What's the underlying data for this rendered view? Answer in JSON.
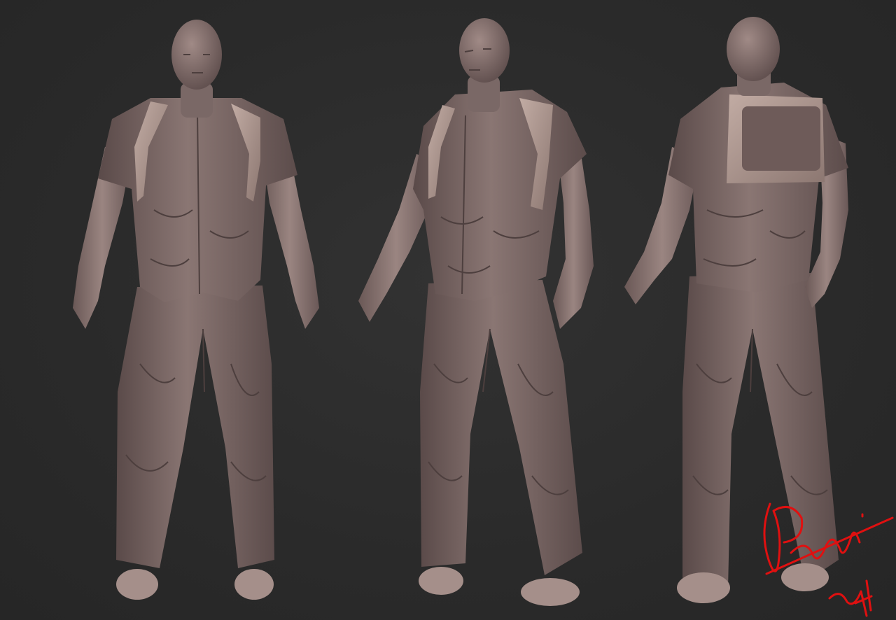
{
  "scene": {
    "background_color": "#2b2b2b",
    "clay_color": "#7a6866",
    "clay_highlight": "#a58f8a",
    "harness_color": "#b39c94",
    "signature_color": "#e01010",
    "views": [
      "front",
      "three-quarter",
      "back"
    ],
    "signature_text": "",
    "signature_year": ""
  }
}
